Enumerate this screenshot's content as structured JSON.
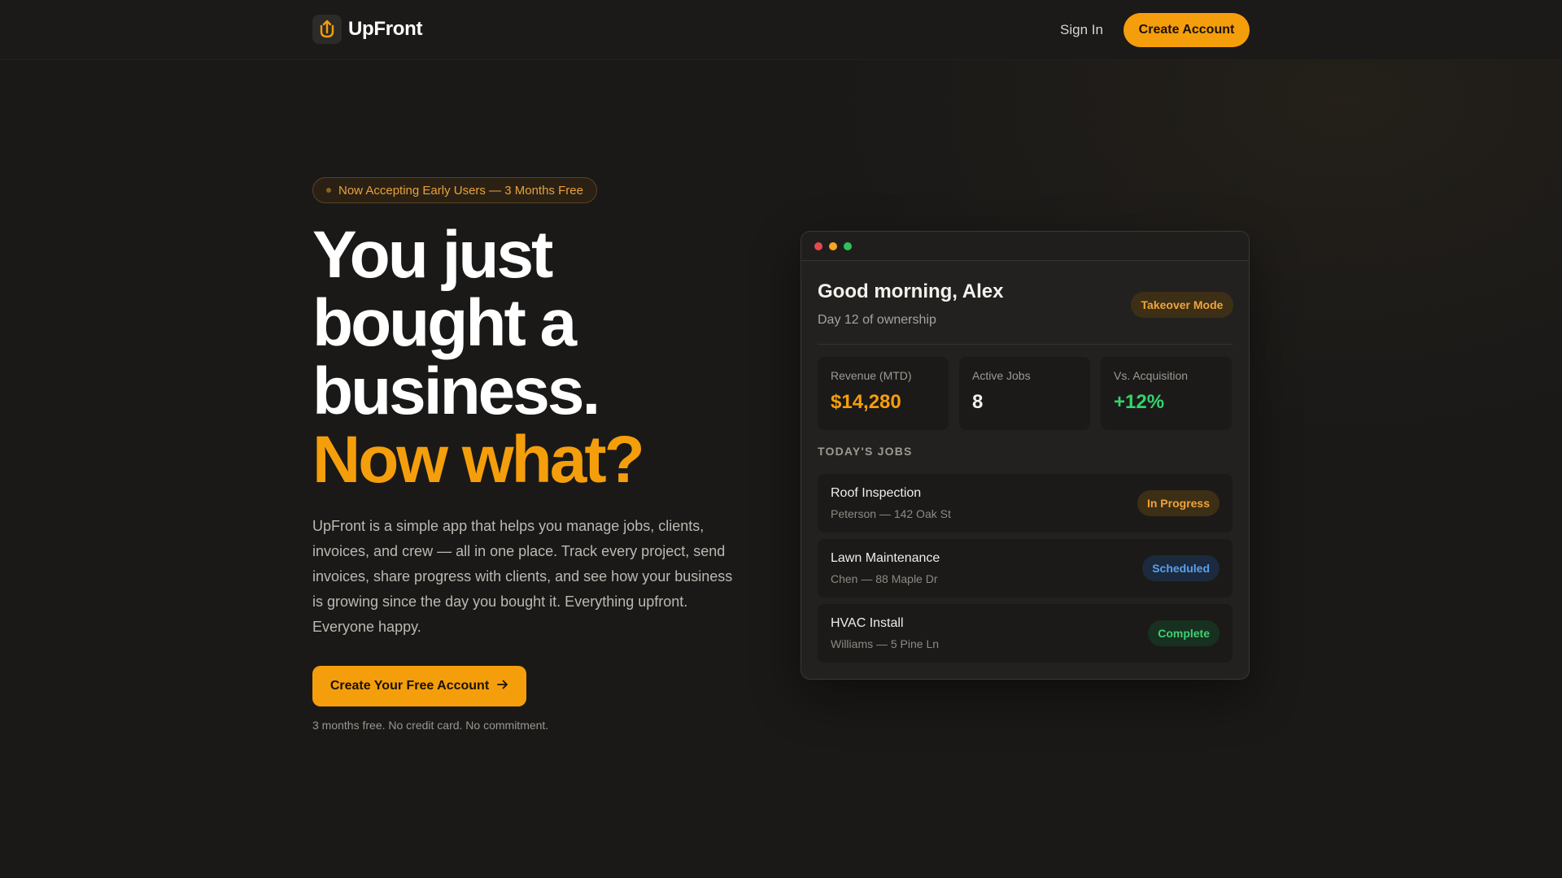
{
  "brand": {
    "name": "UpFront",
    "accent": "#f59e0b"
  },
  "nav": {
    "signin_label": "Sign In",
    "cta_label": "Create Account"
  },
  "hero": {
    "pill_text": "Now Accepting Early Users — 3 Months Free",
    "headline_lines": [
      "You just",
      "bought a",
      "business."
    ],
    "headline_accent": "Now what?",
    "lede": "UpFront is a simple app that helps you manage jobs, clients, invoices, and crew — all in one place. Track every project, send invoices, share progress with clients, and see how your business is growing since the day you bought it. Everything upfront. Everyone happy.",
    "cta_label": "Create Your Free Account",
    "cta_icon": "arrow-right-icon",
    "fine_print": "3 months free. No credit card. No commitment."
  },
  "preview": {
    "window_dots": [
      "#e5484d",
      "#f5a623",
      "#30c15b"
    ],
    "greeting": "Good morning, Alex",
    "subtitle": "Day 12 of ownership",
    "mode_badge": "Takeover Mode",
    "stats": [
      {
        "label": "Revenue (MTD)",
        "value": "$14,280",
        "color": "#f59e0b"
      },
      {
        "label": "Active Jobs",
        "value": "8",
        "color": "#f4f1ec"
      },
      {
        "label": "Vs. Acquisition",
        "value": "+12%",
        "color": "#34d36b"
      }
    ],
    "section_title": "TODAY'S JOBS",
    "jobs": [
      {
        "title": "Roof Inspection",
        "meta": "Peterson — 142 Oak St",
        "status": "In Progress",
        "status_fg": "#f0a43a",
        "status_bg": "#3d2f16"
      },
      {
        "title": "Lawn Maintenance",
        "meta": "Chen — 88 Maple Dr",
        "status": "Scheduled",
        "status_fg": "#5aa0f0",
        "status_bg": "#1c2a3d"
      },
      {
        "title": "HVAC Install",
        "meta": "Williams — 5 Pine Ln",
        "status": "Complete",
        "status_fg": "#3fcf74",
        "status_bg": "#18301f"
      }
    ]
  }
}
